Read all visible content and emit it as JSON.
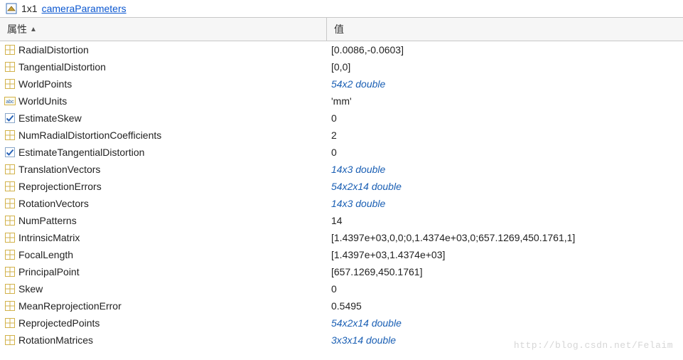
{
  "title": {
    "size": "1x1",
    "className": "cameraParameters"
  },
  "columns": {
    "prop": "属性",
    "val": "值"
  },
  "rows": [
    {
      "icon": "grid",
      "name": "RadialDistortion",
      "value": "[0.0086,-0.0603]",
      "link": false
    },
    {
      "icon": "grid",
      "name": "TangentialDistortion",
      "value": "[0,0]",
      "link": false
    },
    {
      "icon": "grid",
      "name": "WorldPoints",
      "value": "54x2 double",
      "link": true
    },
    {
      "icon": "abc",
      "name": "WorldUnits",
      "value": "'mm'",
      "link": false
    },
    {
      "icon": "check",
      "name": "EstimateSkew",
      "value": "0",
      "link": false
    },
    {
      "icon": "grid",
      "name": "NumRadialDistortionCoefficients",
      "value": "2",
      "link": false
    },
    {
      "icon": "check",
      "name": "EstimateTangentialDistortion",
      "value": "0",
      "link": false
    },
    {
      "icon": "grid",
      "name": "TranslationVectors",
      "value": "14x3 double",
      "link": true
    },
    {
      "icon": "grid",
      "name": "ReprojectionErrors",
      "value": "54x2x14 double",
      "link": true
    },
    {
      "icon": "grid",
      "name": "RotationVectors",
      "value": "14x3 double",
      "link": true
    },
    {
      "icon": "grid",
      "name": "NumPatterns",
      "value": "14",
      "link": false
    },
    {
      "icon": "grid",
      "name": "IntrinsicMatrix",
      "value": "[1.4397e+03,0,0;0,1.4374e+03,0;657.1269,450.1761,1]",
      "link": false
    },
    {
      "icon": "grid",
      "name": "FocalLength",
      "value": "[1.4397e+03,1.4374e+03]",
      "link": false
    },
    {
      "icon": "grid",
      "name": "PrincipalPoint",
      "value": "[657.1269,450.1761]",
      "link": false
    },
    {
      "icon": "grid",
      "name": "Skew",
      "value": "0",
      "link": false
    },
    {
      "icon": "grid",
      "name": "MeanReprojectionError",
      "value": "0.5495",
      "link": false
    },
    {
      "icon": "grid",
      "name": "ReprojectedPoints",
      "value": "54x2x14 double",
      "link": true
    },
    {
      "icon": "grid",
      "name": "RotationMatrices",
      "value": "3x3x14 double",
      "link": true
    }
  ],
  "watermark": "http://blog.csdn.net/Felaim"
}
